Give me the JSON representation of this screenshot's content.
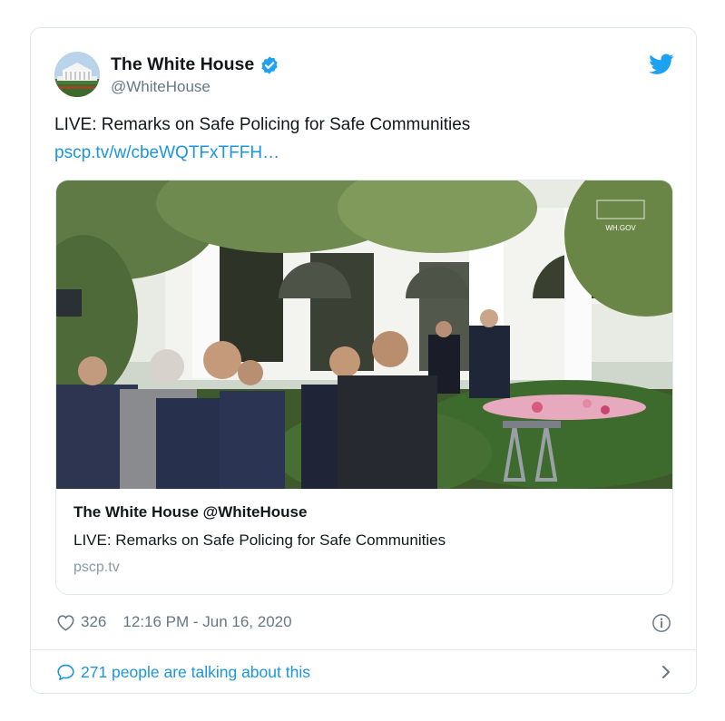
{
  "tweet": {
    "display_name": "The White House",
    "handle": "@WhiteHouse",
    "text": "LIVE: Remarks on Safe Policing for Safe Communities",
    "link": "pscp.tv/w/cbeWQTFxTFFH…",
    "card": {
      "title": "The White House @WhiteHouse",
      "description": "LIVE: Remarks on Safe Policing for Safe Communities",
      "domain": "pscp.tv",
      "watermark": "WH.GOV"
    },
    "likes": "326",
    "timestamp": "12:16 PM - Jun 16, 2020",
    "talking": "271 people are talking about this"
  },
  "icons": {
    "verified": "verified-badge-icon",
    "brand": "twitter-bird-icon",
    "like": "heart-icon",
    "info": "info-icon",
    "reply": "speech-bubble-icon",
    "more": "chevron-right-icon"
  },
  "colors": {
    "link": "#1b95e0",
    "verified": "#1da1f2",
    "secondary_text": "#657786",
    "border": "#e1e8ed"
  }
}
